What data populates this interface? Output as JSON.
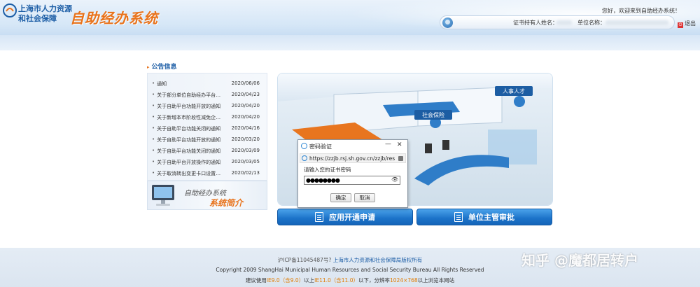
{
  "header": {
    "org_line1": "上海市人力资源",
    "org_line2": "和社会保障",
    "system_title": "自助经办系统",
    "welcome": "您好，欢迎来到自助经办系统！",
    "user_label": "证书持有人姓名：",
    "unit_label": "单位名称：",
    "logout": "退出"
  },
  "notices": {
    "heading": "公告信息",
    "items": [
      {
        "title": "通知",
        "date": "2020/06/06"
      },
      {
        "title": "关于部分单位自助经办平台…",
        "date": "2020/04/23"
      },
      {
        "title": "关于自助平台功能开放的通知",
        "date": "2020/04/20"
      },
      {
        "title": "关于新增本市阶段性减免企…",
        "date": "2020/04/20"
      },
      {
        "title": "关于自助平台功能关闭的通知",
        "date": "2020/04/16"
      },
      {
        "title": "关于自助平台功能开放的通知",
        "date": "2020/03/20"
      },
      {
        "title": "关于自助平台功能关闭的通知",
        "date": "2020/03/09"
      },
      {
        "title": "关于自助平台开放操作的通知",
        "date": "2020/03/05"
      },
      {
        "title": "关于取消转出变更卡口设置…",
        "date": "2020/02/13"
      }
    ]
  },
  "intro_banner": {
    "line1": "自助经办系统",
    "line2": "系统简介"
  },
  "illustration": {
    "sign1": "社会保险",
    "sign2": "人事人才"
  },
  "buttons": {
    "apply": "应用开通申请",
    "approve": "单位主管审批"
  },
  "dialog": {
    "title": "密码验证",
    "url": "https://zzjb.rsj.sh.gov.cn/zzjb/res",
    "prompt": "请输入您的证书密码",
    "password_mask": "●●●●●●●●",
    "ok": "确定",
    "cancel": "取消"
  },
  "footer": {
    "icp": "沪ICP备11045487号?",
    "owner": "上海市人力资源和社会保障局版权所有",
    "copyright": "Copyright 2009 ShangHai Municipal Human Resources and Social Security Bureau All Rights Reserved",
    "advice_prefix": "建议使用",
    "ie9": "IE9.0（含9.0）",
    "mid1": "以上",
    "ie11": "IE11.0（含11.0）",
    "mid2": "以下，分辨率",
    "resolution": "1024×768",
    "suffix": "以上浏览本网站"
  },
  "watermark": "知乎 @魔都居转户",
  "colors": {
    "brand_blue": "#1d5ea6",
    "accent_orange": "#e8731c",
    "button_blue": "#1b72c8"
  }
}
